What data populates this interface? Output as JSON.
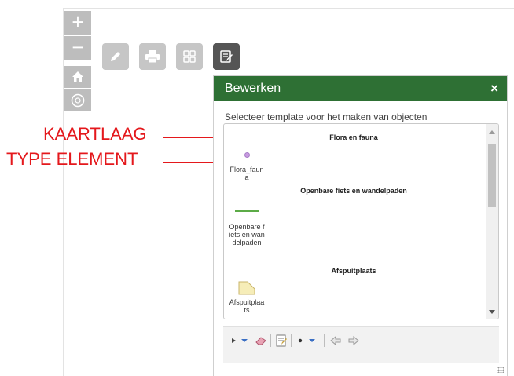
{
  "map_controls": {
    "zoom_in_label": "+",
    "zoom_out_label": "−",
    "buttons": [
      "zoom-in",
      "zoom-out",
      "home-icon",
      "locate-icon"
    ]
  },
  "toolbar": {
    "tools": [
      {
        "icon": "pencil-icon",
        "active": false
      },
      {
        "icon": "print-icon",
        "active": false
      },
      {
        "icon": "grid-icon",
        "active": false
      },
      {
        "icon": "edit-form-icon",
        "active": true
      }
    ]
  },
  "annotations": {
    "kaartlaag": "KAARTLAAG",
    "type_element": "TYPE ELEMENT",
    "color": "#e4181c"
  },
  "panel": {
    "title": "Bewerken",
    "close_label": "×",
    "header_color": "#2e7034",
    "subtitle": "Selecteer template voor het maken van objecten",
    "layers": [
      {
        "title": "Flora en fauna",
        "template": {
          "label": "Flora_fauna",
          "symbol": "point"
        }
      },
      {
        "title": "Openbare fiets en wandelpaden",
        "template": {
          "label": "Openbare fiets en wandelpaden",
          "symbol": "line"
        }
      },
      {
        "title": "Afspuitplaats",
        "template": {
          "label": "Afspuitplaats",
          "symbol": "polygon"
        }
      }
    ]
  },
  "edit_toolbar": {
    "tools": [
      "select-arrow-icon",
      "dropdown-icon",
      "eraser-icon",
      "attributes-icon",
      "point-icon",
      "dropdown-icon",
      "undo-icon",
      "redo-icon"
    ]
  }
}
